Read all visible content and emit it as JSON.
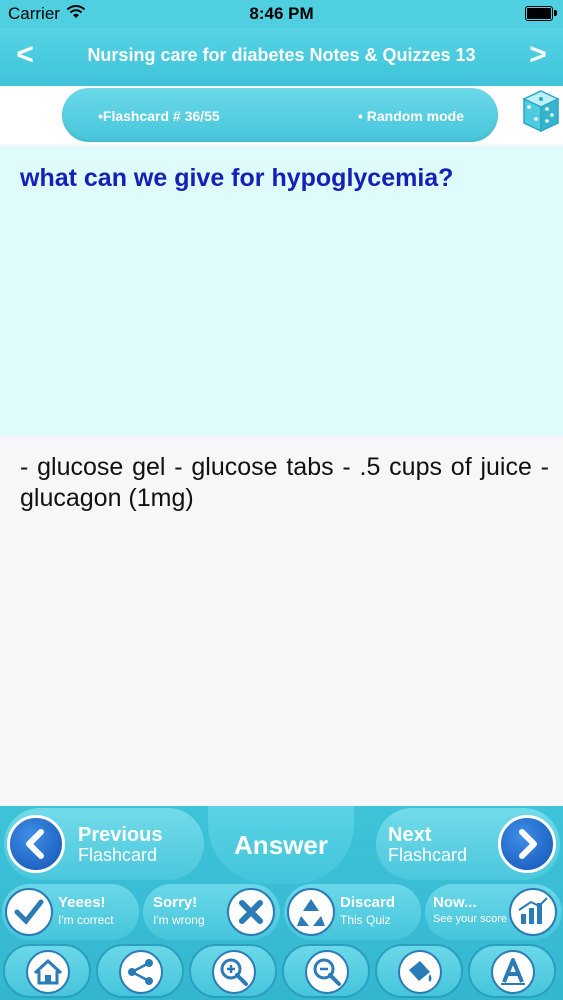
{
  "status_bar": {
    "carrier": "Carrier",
    "time": "8:46 PM"
  },
  "nav": {
    "title": "Nursing care for diabetes Notes & Quizzes 13",
    "back_glyph": "<",
    "forward_glyph": ">"
  },
  "info": {
    "flashcard_label": "•Flashcard #  36/55",
    "mode_label": "• Random mode"
  },
  "card": {
    "question": "what can we give for hypoglycemia?",
    "answer": "- glucose gel - glucose tabs - .5 cups of juice - glucagon (1mg)"
  },
  "toolbar": {
    "previous": {
      "line1": "Previous",
      "line2": "Flashcard"
    },
    "answer": "Answer",
    "next": {
      "line1": "Next",
      "line2": "Flashcard"
    },
    "yes": {
      "line1": "Yeees!",
      "line2": "I'm correct"
    },
    "sorry": {
      "line1": "Sorry!",
      "line2": "I'm wrong"
    },
    "discard": {
      "line1": "Discard",
      "line2": "This Quiz"
    },
    "score": {
      "line1": "Now...",
      "line2": "See your score"
    }
  },
  "icons": [
    "wifi-icon",
    "battery-icon",
    "dice-icon",
    "checkmark-icon",
    "x-icon",
    "recycle-icon",
    "chart-icon",
    "home-icon",
    "share-icon",
    "zoom-in-icon",
    "zoom-out-icon",
    "paint-bucket-icon",
    "font-icon"
  ],
  "colors": {
    "accent": "#45c6dc",
    "question_text": "#1420b8",
    "question_bg": "#dffbfc",
    "arrow_blue": "#1352b6"
  }
}
